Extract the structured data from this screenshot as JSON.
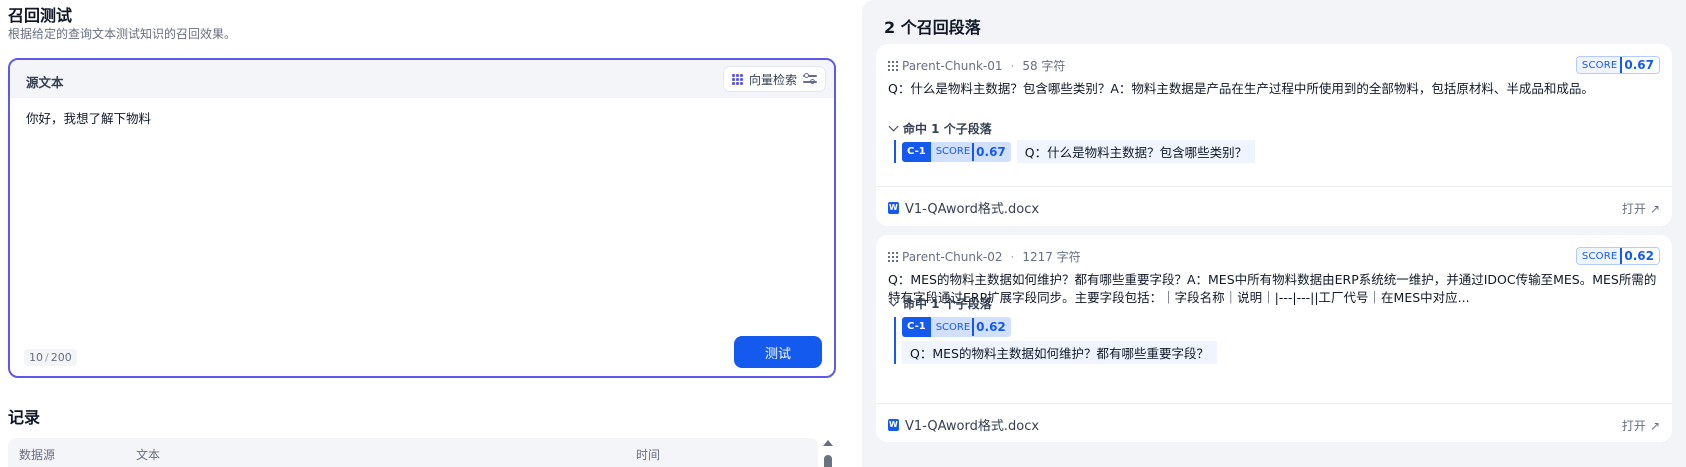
{
  "left": {
    "title": "召回测试",
    "subtitle": "根据给定的查询文本测试知识的召回效果。",
    "source": {
      "label": "源文本",
      "mode_label": "向量检索",
      "query": "你好，我想了解下物料",
      "char_count": "10",
      "char_max": "200",
      "test_button": "测试"
    },
    "records": {
      "title": "记录",
      "columns": [
        "数据源",
        "文本",
        "时间"
      ]
    }
  },
  "right": {
    "title": "2 个召回段落",
    "score_label": "SCORE",
    "open_label": "打开",
    "results": [
      {
        "chunk_id": "Parent-Chunk-01",
        "char_count": "58 字符",
        "score": "0.67",
        "content": "Q：什么是物料主数据？包含哪些类别？A：物料主数据是产品在生产过程中所使用到的全部物料，包括原材料、半成品和成品。",
        "hit_label": "命中 1 个子段落",
        "child": {
          "id": "C-1",
          "score": "0.67",
          "text": "Q：什么是物料主数据？包含哪些类别？"
        },
        "document": "V1-QAword格式.docx"
      },
      {
        "chunk_id": "Parent-Chunk-02",
        "char_count": "1217 字符",
        "score": "0.62",
        "content": "Q：MES的物料主数据如何维护？都有哪些重要字段？A：MES中所有物料数据由ERP系统统一维护，并通过IDOC传输至MES。MES所需的特有字段通过ERP扩展字段同步。主要字段包括：｜字段名称｜说明｜|---|---||工厂代号｜在MES中对应...",
        "hit_label": "命中 1 个子段落",
        "child": {
          "id": "C-1",
          "score": "0.62",
          "text": "Q：MES的物料主数据如何维护？都有哪些重要字段？"
        },
        "document": "V1-QAword格式.docx"
      }
    ]
  },
  "colors": {
    "accent": "#155aef",
    "focus_border": "#5e59e6",
    "panel_bg": "#f2f4f7"
  }
}
